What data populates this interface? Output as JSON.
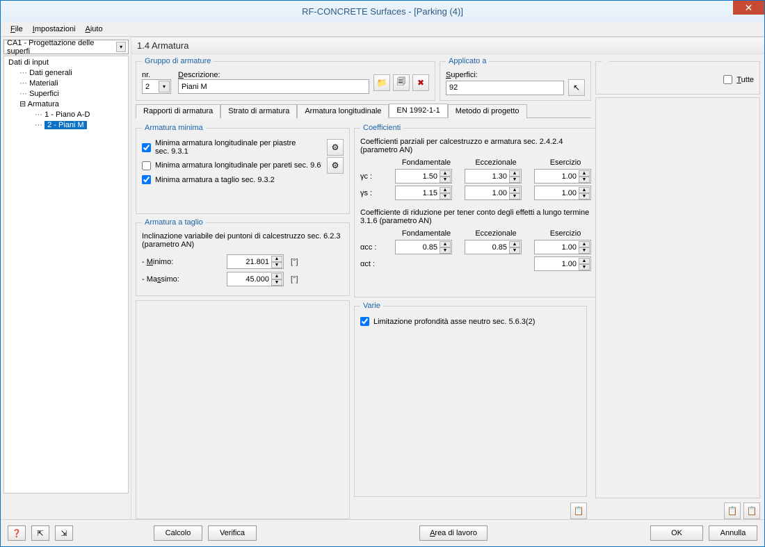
{
  "window": {
    "title": "RF-CONCRETE Surfaces - [Parking (4)]"
  },
  "menu": {
    "file": "File",
    "settings": "Impostazioni",
    "help": "Aiuto"
  },
  "leftCombo": "CA1 - Progettazione delle superfi",
  "tree": {
    "root": "Dati di input",
    "items": [
      "Dati generali",
      "Materiali",
      "Superfici"
    ],
    "armatura": "Armatura",
    "sub": [
      "1 - Piano A-D",
      "2 - Piani M"
    ]
  },
  "sectionTitle": "1.4 Armatura",
  "group": {
    "legend": "Gruppo di armature",
    "nrLabel": "nr.",
    "nrValue": "2",
    "descrLabel": "Descrizione:",
    "descrValue": "Piani M"
  },
  "appliedTo": {
    "legend": "Applicato a",
    "label": "Superfici:",
    "value": "92",
    "all": "Tutte"
  },
  "tabs": {
    "t0": "Rapporti di armatura",
    "t1": "Strato di armatura",
    "t2": "Armatura longitudinale",
    "t3": "EN 1992-1-1",
    "t4": "Metodo di progetto"
  },
  "minArm": {
    "legend": "Armatura minima",
    "c1": "Minima armatura longitudinale per piastre sec. 9.3.1",
    "c2": "Minima armatura longitudinale per pareti sec. 9.6",
    "c3": "Minima armatura a taglio sec. 9.3.2"
  },
  "shear": {
    "legend": "Armatura a taglio",
    "text": "Inclinazione variabile dei puntoni di calcestruzzo sec. 6.2.3 (parametro AN)",
    "min": "- Minimo:",
    "minVal": "21.801",
    "max": "- Massimo:",
    "maxVal": "45.000",
    "unit": "[°]"
  },
  "coef": {
    "legend": "Coefficienti",
    "text1": "Coefficienti parziali per calcestruzzo e armatura sec. 2.4.2.4 (parametro AN)",
    "h1": "Fondamentale",
    "h2": "Eccezionale",
    "h3": "Esercizio",
    "r1": "γc :",
    "r1a": "1.50",
    "r1b": "1.30",
    "r1c": "1.00",
    "r2": "γs :",
    "r2a": "1.15",
    "r2b": "1.00",
    "r2c": "1.00",
    "text2": "Coefficiente di riduzione per tener conto degli effetti a lungo termine 3.1.6 (parametro AN)",
    "r3": "αcc :",
    "r3a": "0.85",
    "r3b": "0.85",
    "r3c": "1.00",
    "r4": "αct :",
    "r4c": "1.00"
  },
  "varie": {
    "legend": "Varie",
    "c1": "Limitazione profondità asse neutro sec. 5.6.3(2)"
  },
  "buttons": {
    "calc": "Calcolo",
    "verify": "Verifica",
    "workarea": "Area di lavoro",
    "ok": "OK",
    "cancel": "Annulla"
  }
}
